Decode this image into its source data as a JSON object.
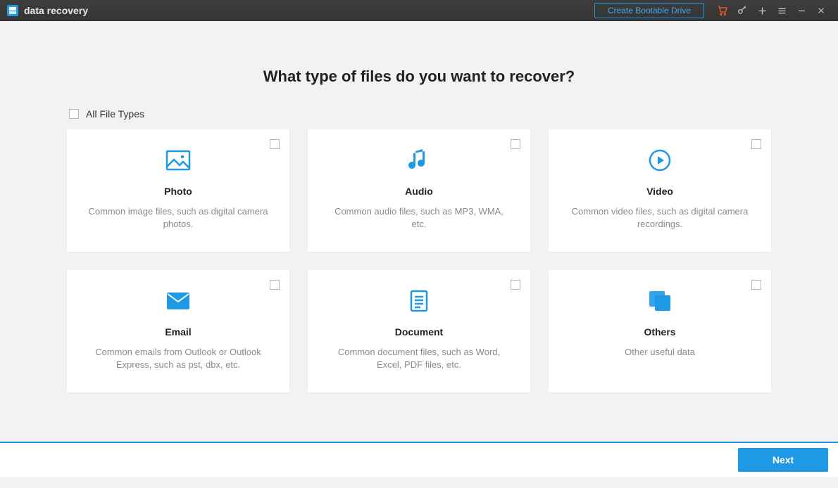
{
  "titlebar": {
    "app_name": "data recovery",
    "bootable_label": "Create Bootable Drive"
  },
  "main": {
    "heading": "What type of files do you want to recover?",
    "all_files_label": "All File Types",
    "cards": [
      {
        "id": "photo",
        "title": "Photo",
        "desc": "Common image files, such as digital camera photos."
      },
      {
        "id": "audio",
        "title": "Audio",
        "desc": "Common audio files, such as MP3, WMA, etc."
      },
      {
        "id": "video",
        "title": "Video",
        "desc": "Common video files, such as digital camera recordings."
      },
      {
        "id": "email",
        "title": "Email",
        "desc": "Common emails from Outlook or Outlook Express, such as pst, dbx, etc."
      },
      {
        "id": "document",
        "title": "Document",
        "desc": "Common document files, such as Word, Excel, PDF files, etc."
      },
      {
        "id": "others",
        "title": "Others",
        "desc": "Other useful data"
      }
    ]
  },
  "footer": {
    "next_label": "Next"
  },
  "colors": {
    "accent": "#1f99e6",
    "cart": "#ff5a2b",
    "titlebar": "#383838"
  }
}
